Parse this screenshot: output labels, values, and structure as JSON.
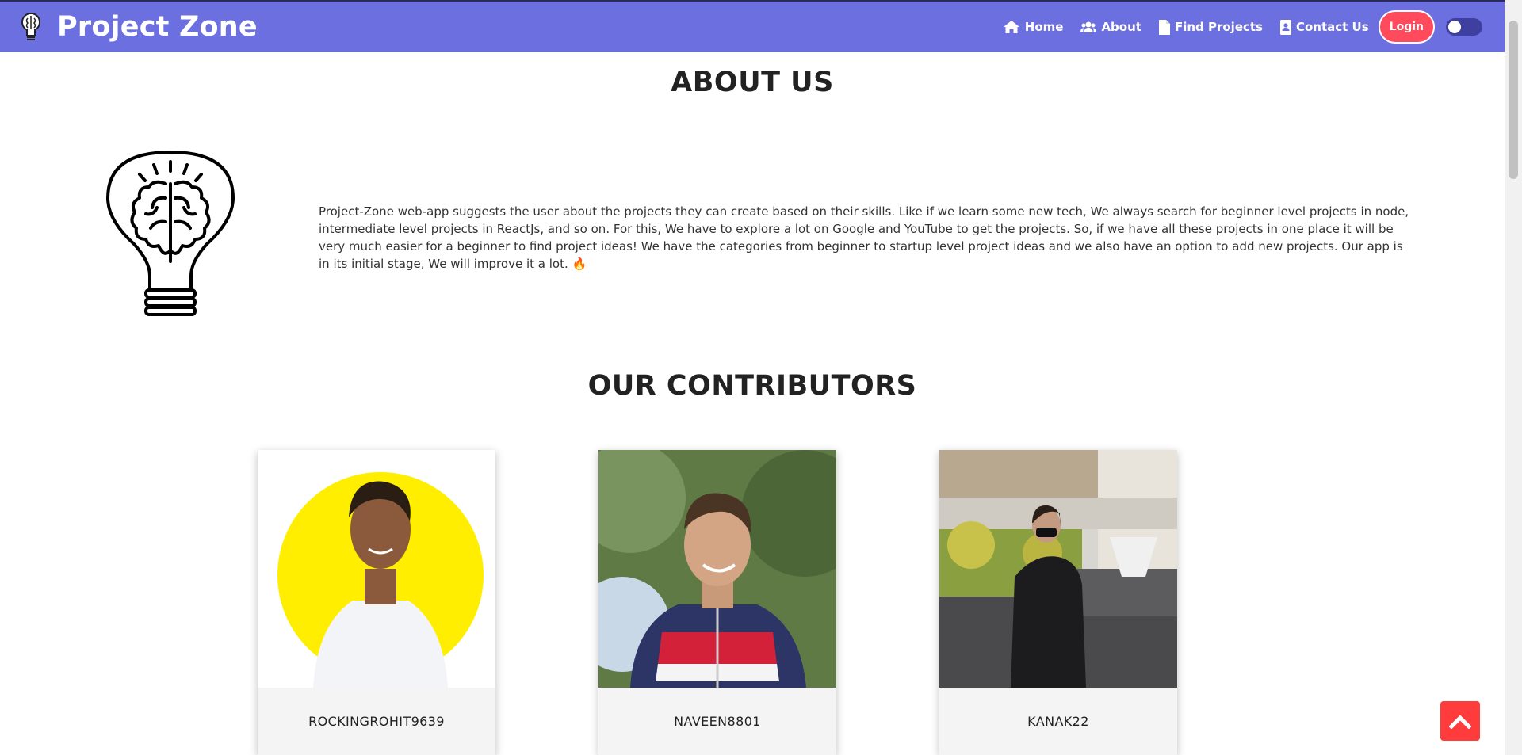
{
  "brand": {
    "title": "Project Zone"
  },
  "nav": {
    "items": [
      {
        "label": "Home",
        "icon": "home-icon"
      },
      {
        "label": "About",
        "icon": "users-icon"
      },
      {
        "label": "Find Projects",
        "icon": "file-icon"
      },
      {
        "label": "Contact Us",
        "icon": "contact-card-icon"
      }
    ],
    "login_label": "Login"
  },
  "about": {
    "title": "ABOUT US",
    "text": "Project-Zone web-app suggests the user about the projects they can create based on their skills. Like if we learn some new tech, We always search for beginner level projects in node, intermediate level projects in ReactJs, and so on. For this, We have to explore a lot on Google and YouTube to get the projects. So, if we have all these projects in one place it will be very much easier for a beginner to find project ideas! We have the categories from beginner to startup level project ideas and we also have an option to add new projects. Our app is in its initial stage, We will improve it a lot. 🔥"
  },
  "contributors": {
    "title": "OUR CONTRIBUTORS",
    "items": [
      {
        "name": "ROCKINGROHIT9639"
      },
      {
        "name": "NAVEEN8801"
      },
      {
        "name": "KANAK22"
      }
    ]
  },
  "colors": {
    "navbar": "#6c6fe0",
    "login": "#ff4b5c",
    "scroll_top": "#ff3b3b",
    "card_name_bg": "#f4f4f4"
  }
}
